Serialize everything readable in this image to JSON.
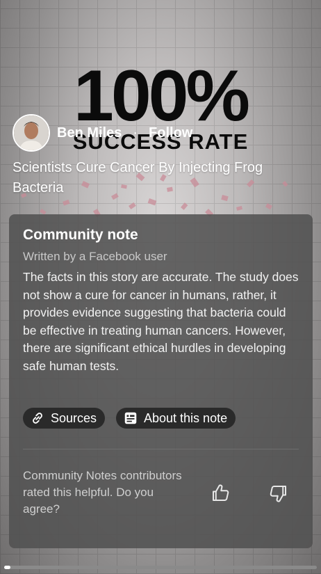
{
  "video": {
    "headline_big": "100%",
    "headline_small": "SUCCESS RATE",
    "progress": 0.02
  },
  "author": {
    "name": "Ben Miles",
    "separator": "·",
    "follow_label": "Follow"
  },
  "post": {
    "title": "Scientists Cure Cancer By Injecting Frog Bacteria"
  },
  "community_note": {
    "title": "Community note",
    "subtitle": "Written by a Facebook user",
    "body": "The facts in this story are accurate. The study does not show a cure for cancer in humans, rather, it provides evidence suggesting that bacteria could be effective in treating human cancers. However, there are significant ethical hurdles in developing safe human tests.",
    "sources_label": "Sources",
    "about_label": "About this note",
    "question": "Community Notes contributors rated this helpful. Do you agree?"
  },
  "icons": {
    "sources": "link-icon",
    "about": "note-icon",
    "agree": "thumbs-up-icon",
    "disagree": "thumbs-down-icon"
  }
}
